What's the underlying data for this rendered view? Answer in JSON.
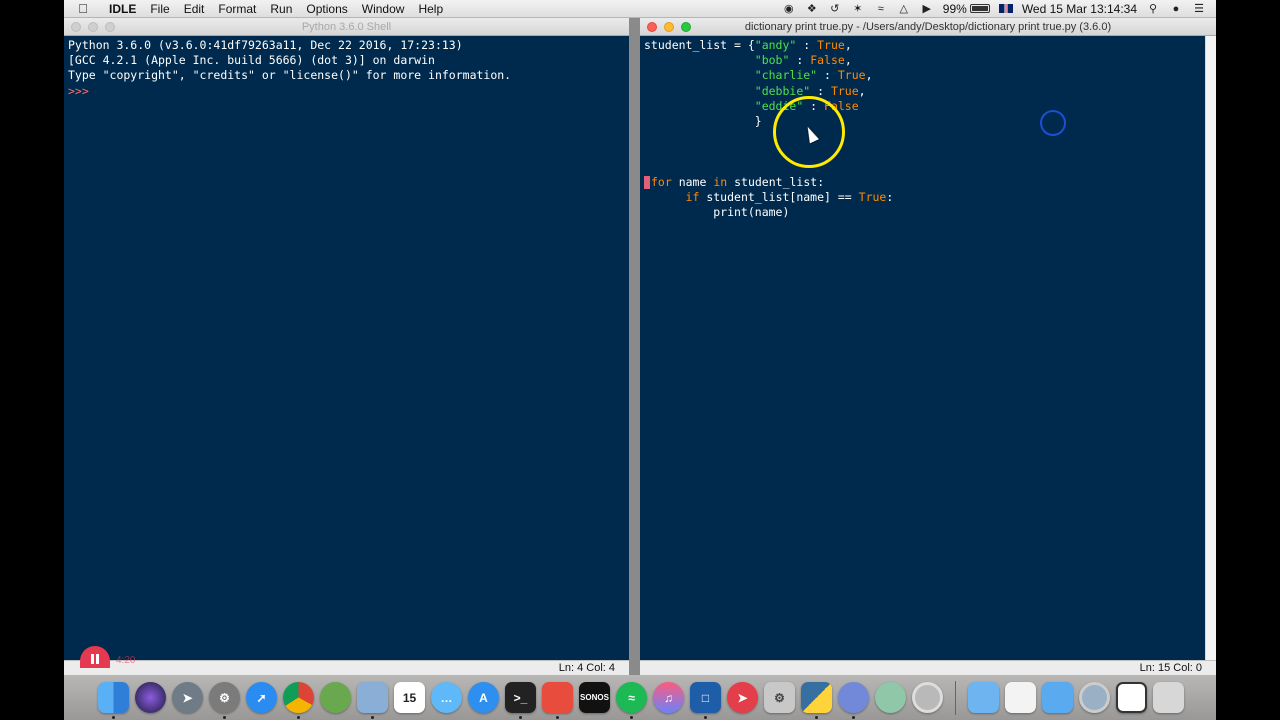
{
  "menubar": {
    "app_name": "IDLE",
    "items": [
      "File",
      "Edit",
      "Format",
      "Run",
      "Options",
      "Window",
      "Help"
    ],
    "battery": "99%",
    "datetime": "Wed 15 Mar  13:14:34"
  },
  "shell": {
    "title": "Python 3.6.0 Shell",
    "lines": [
      "Python 3.6.0 (v3.6.0:41df79263a11, Dec 22 2016, 17:23:13)",
      "[GCC 4.2.1 (Apple Inc. build 5666) (dot 3)] on darwin",
      "Type \"copyright\", \"credits\" or \"license()\" for more information."
    ],
    "prompt": ">>>",
    "status": "Ln: 4   Col: 4"
  },
  "editor": {
    "title": "dictionary print true.py - /Users/andy/Desktop/dictionary print true.py (3.6.0)",
    "status": "Ln: 15   Col: 0"
  },
  "recording": {
    "time": "4:20"
  },
  "dock": {
    "apps": [
      "Finder",
      "Siri",
      "Launchpad",
      "System Preferences",
      "Safari",
      "Chrome",
      "Automator",
      "Preview",
      "Calendar",
      "Messages",
      "App Store",
      "Terminal",
      "Screen Recorder",
      "Sonos",
      "Spotify",
      "iTunes",
      "Screens",
      "Airmail",
      "Settings",
      "Python Launcher",
      "Discord",
      "Alien",
      "Disk Utility"
    ],
    "calendar_day": "15",
    "sonos_label": "SONOS"
  }
}
